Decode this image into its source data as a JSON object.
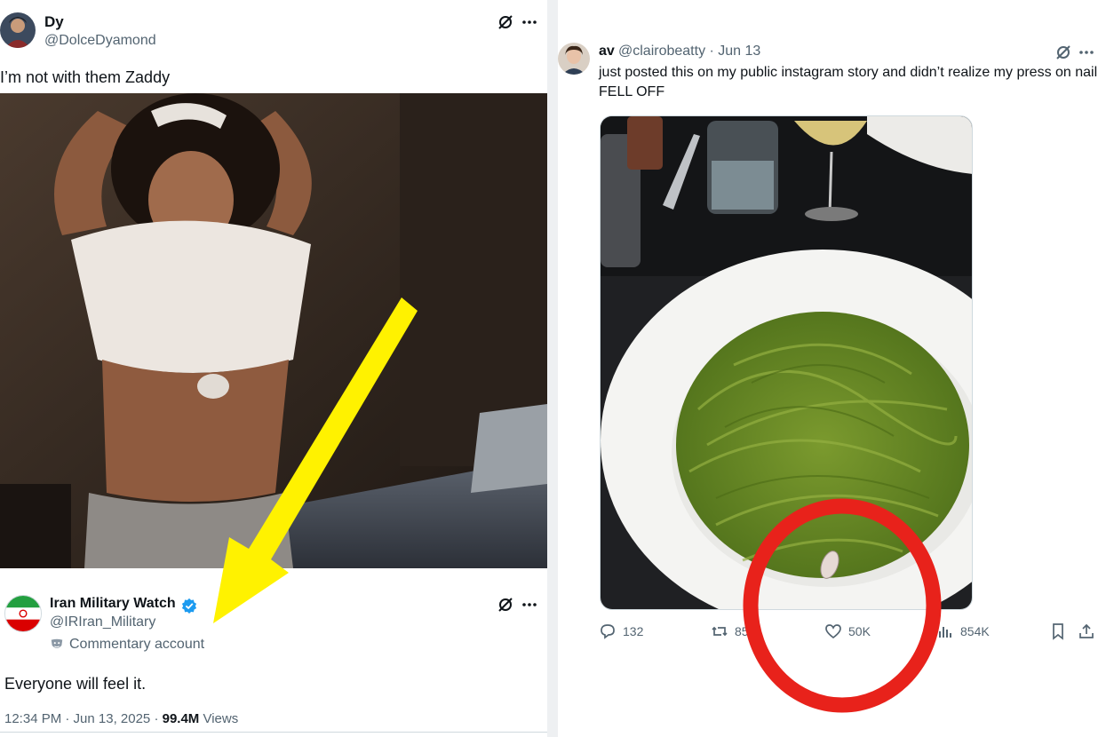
{
  "left_tweet": {
    "author_name": "Dy",
    "author_handle": "@DolceDyamond",
    "text": "I’m not with them Zaddy",
    "avatar_icon": "avatar-dy-icon",
    "quoted": {
      "author_name": "Iran Military Watch",
      "author_handle": "@IRIran_Military",
      "account_label": "Commentary account",
      "text": "Everyone will feel it.",
      "time": "12:34 PM · Jun 13, 2025 · ",
      "views_count": "99.4M",
      "views_label": " Views",
      "verified_color": "#1d9bf0"
    }
  },
  "right_tweet": {
    "author_name": "av",
    "author_handle": "@clairobeatty · Jun 13",
    "text": "just posted this on my public instagram story and didn’t realize my press on nail FELL OFF",
    "actions": {
      "replies": "132",
      "retweets": "85",
      "likes": "50K",
      "views": "854K"
    }
  },
  "overlays": {
    "arrow_color": "#fff200",
    "circle_color": "#e8221b"
  }
}
